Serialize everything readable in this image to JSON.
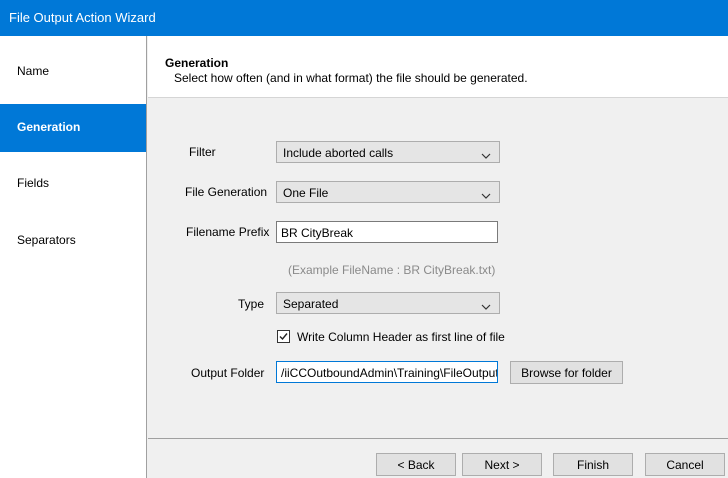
{
  "window": {
    "title": "File Output Action Wizard"
  },
  "sidebar": {
    "items": [
      {
        "label": "Name"
      },
      {
        "label": "Generation"
      },
      {
        "label": "Fields"
      },
      {
        "label": "Separators"
      }
    ]
  },
  "header": {
    "title": "Generation",
    "subtitle": "Select how often (and in what format) the file should be generated."
  },
  "form": {
    "filter_label": "Filter",
    "filter_value": "Include aborted calls",
    "generation_label": "File Generation",
    "generation_value": "One File",
    "prefix_label": "Filename Prefix",
    "prefix_value": "BR CityBreak",
    "example_text": "(Example FileName : BR CityBreak.txt)",
    "type_label": "Type",
    "type_value": "Separated",
    "write_header_label": "Write Column Header as first line of file",
    "write_header_checked": true,
    "output_label": "Output Folder",
    "output_value": "/iiCCOutboundAdmin\\Training\\FileOutput",
    "browse_label": "Browse for folder"
  },
  "footer": {
    "back_label": "< Back",
    "next_label": "Next >",
    "finish_label": "Finish",
    "cancel_label": "Cancel"
  }
}
